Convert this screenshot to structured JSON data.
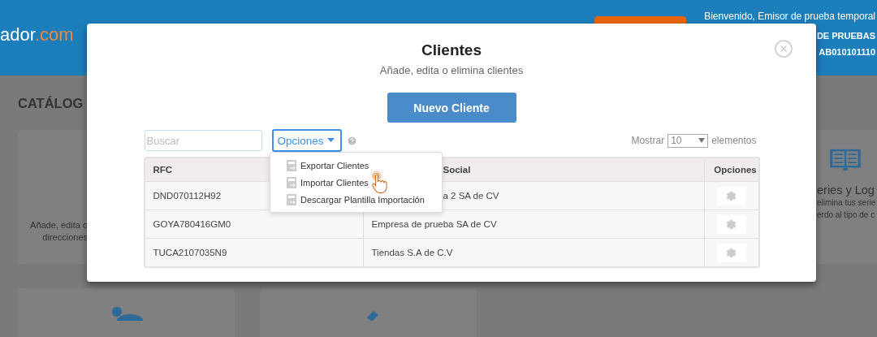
{
  "header": {
    "logo": {
      "name": "ador",
      "suffix": ".com"
    },
    "welcome": "Bienvenido, Emisor de prueba temporal",
    "user_lines": [
      "DE PRUEBAS",
      "AB010101110"
    ]
  },
  "page": {
    "heading": "CATÁLOG",
    "cards": [
      {
        "kind": "text",
        "lines": [
          "Añade, edita o",
          "direcciones"
        ]
      },
      {
        "kind": "hidden"
      },
      {
        "kind": "hidden"
      },
      {
        "kind": "titled",
        "title": "eries y Log",
        "lines": [
          "elimina tus serie",
          "erdo al tipo de c"
        ]
      },
      {
        "kind": "people"
      },
      {
        "kind": "pencil"
      }
    ]
  },
  "modal": {
    "title": "Clientes",
    "subtitle": "Añade, edita o elimina clientes",
    "new_button": "Nuevo Cliente",
    "search": {
      "placeholder": "Buscar"
    },
    "options_button": "Opciones",
    "show": {
      "label": "Mostrar",
      "value": "10",
      "suffix": "elementos"
    },
    "table": {
      "columns": [
        "RFC",
        "Social",
        "Opciones"
      ],
      "rows": [
        {
          "rfc": "DND070112H92",
          "name": "a 2 SA de CV"
        },
        {
          "rfc": "GOYA780416GM0",
          "name": "Empresa de prueba SA de CV"
        },
        {
          "rfc": "TUCA2107035N9",
          "name": "Tiendas S.A de C.V"
        }
      ]
    },
    "menu": {
      "open": true,
      "items": [
        {
          "label": "Exportar Clientes"
        },
        {
          "label": "Importar Clientes"
        },
        {
          "label": "Descargar Plantilla Importación"
        }
      ]
    }
  }
}
